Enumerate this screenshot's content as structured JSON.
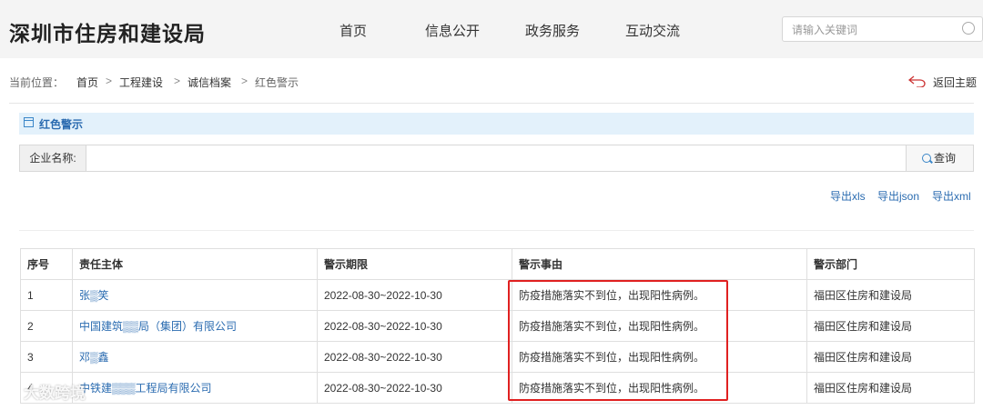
{
  "header": {
    "logo": "深圳市住房和建设局",
    "nav": [
      "首页",
      "信息公开",
      "政务服务",
      "互动交流"
    ],
    "search_placeholder": "请输入关键词"
  },
  "breadcrumb": {
    "label": "当前位置：",
    "items": [
      "首页",
      "工程建设",
      "诚信档案",
      "红色警示"
    ],
    "separator": ">",
    "back": "返回主题"
  },
  "section": {
    "title": "红色警示"
  },
  "filter": {
    "label": "企业名称:",
    "value": "",
    "button": "查询"
  },
  "exports": [
    "导出xls",
    "导出json",
    "导出xml"
  ],
  "table": {
    "headers": [
      "序号",
      "责任主体",
      "警示期限",
      "警示事由",
      "警示部门"
    ],
    "rows": [
      [
        "1",
        "张▒笑",
        "2022-08-30~2022-10-30",
        "防疫措施落实不到位，出现阳性病例。",
        "福田区住房和建设局"
      ],
      [
        "2",
        "中国建筑▒▒局（集团）有限公司",
        "2022-08-30~2022-10-30",
        "防疫措施落实不到位，出现阳性病例。",
        "福田区住房和建设局"
      ],
      [
        "3",
        "邓▒鑫",
        "2022-08-30~2022-10-30",
        "防疫措施落实不到位，出现阳性病例。",
        "福田区住房和建设局"
      ],
      [
        "4",
        "中铁建▒▒▒工程局有限公司",
        "2022-08-30~2022-10-30",
        "防疫措施落实不到位，出现阳性病例。",
        "福田区住房和建设局"
      ]
    ]
  },
  "watermark": "大数跨境",
  "colors": {
    "accent": "#2a6bb0",
    "highlight_border": "#e02020",
    "section_bg": "#e3f1fb"
  }
}
